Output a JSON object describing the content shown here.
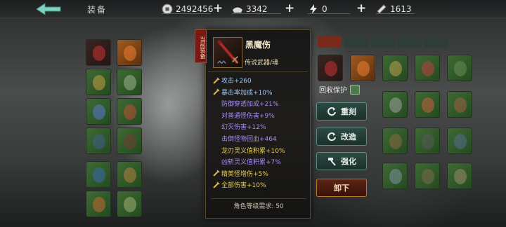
{
  "header": {
    "title": "装备"
  },
  "resources": [
    {
      "icon": "coin-icon",
      "value": "2492456"
    },
    {
      "icon": "ingot-icon",
      "value": "3342"
    },
    {
      "icon": "lightning-icon",
      "value": "0"
    },
    {
      "icon": "ticket-icon",
      "value": "1613"
    }
  ],
  "item": {
    "tag": "当前装备",
    "name": "黑魔伤",
    "type": "传说武器/魂",
    "stats": [
      {
        "text": "攻击+260",
        "color": "#9ec7ee",
        "bullet": true
      },
      {
        "text": "暴击率加成+10%",
        "color": "#9ec7ee",
        "bullet": true
      },
      {
        "text": "防御穿透加成+21%",
        "color": "#a98cf2",
        "bullet": false
      },
      {
        "text": "对普通怪伤害+9%",
        "color": "#a98cf2",
        "bullet": false
      },
      {
        "text": "幻灭伤害+12%",
        "color": "#a98cf2",
        "bullet": false
      },
      {
        "text": "击倒怪物回血+464",
        "color": "#a98cf2",
        "bullet": false
      },
      {
        "text": "龙刃灵义值积累+10%",
        "color": "#e6cf58",
        "bullet": false
      },
      {
        "text": "凶斩灵义值积累+7%",
        "color": "#a98cf2",
        "bullet": false
      },
      {
        "text": "精英怪增伤+5%",
        "color": "#e6cf58",
        "bullet": true
      },
      {
        "text": "全部伤害+10%",
        "color": "#e6cf58",
        "bullet": true
      }
    ],
    "level_requirement": "角色等级需求: 50"
  },
  "actions": {
    "recycle_protect": "回收保护",
    "reforge": "重刻",
    "transform": "改造",
    "enhance": "强化",
    "unequip": "卸下"
  }
}
